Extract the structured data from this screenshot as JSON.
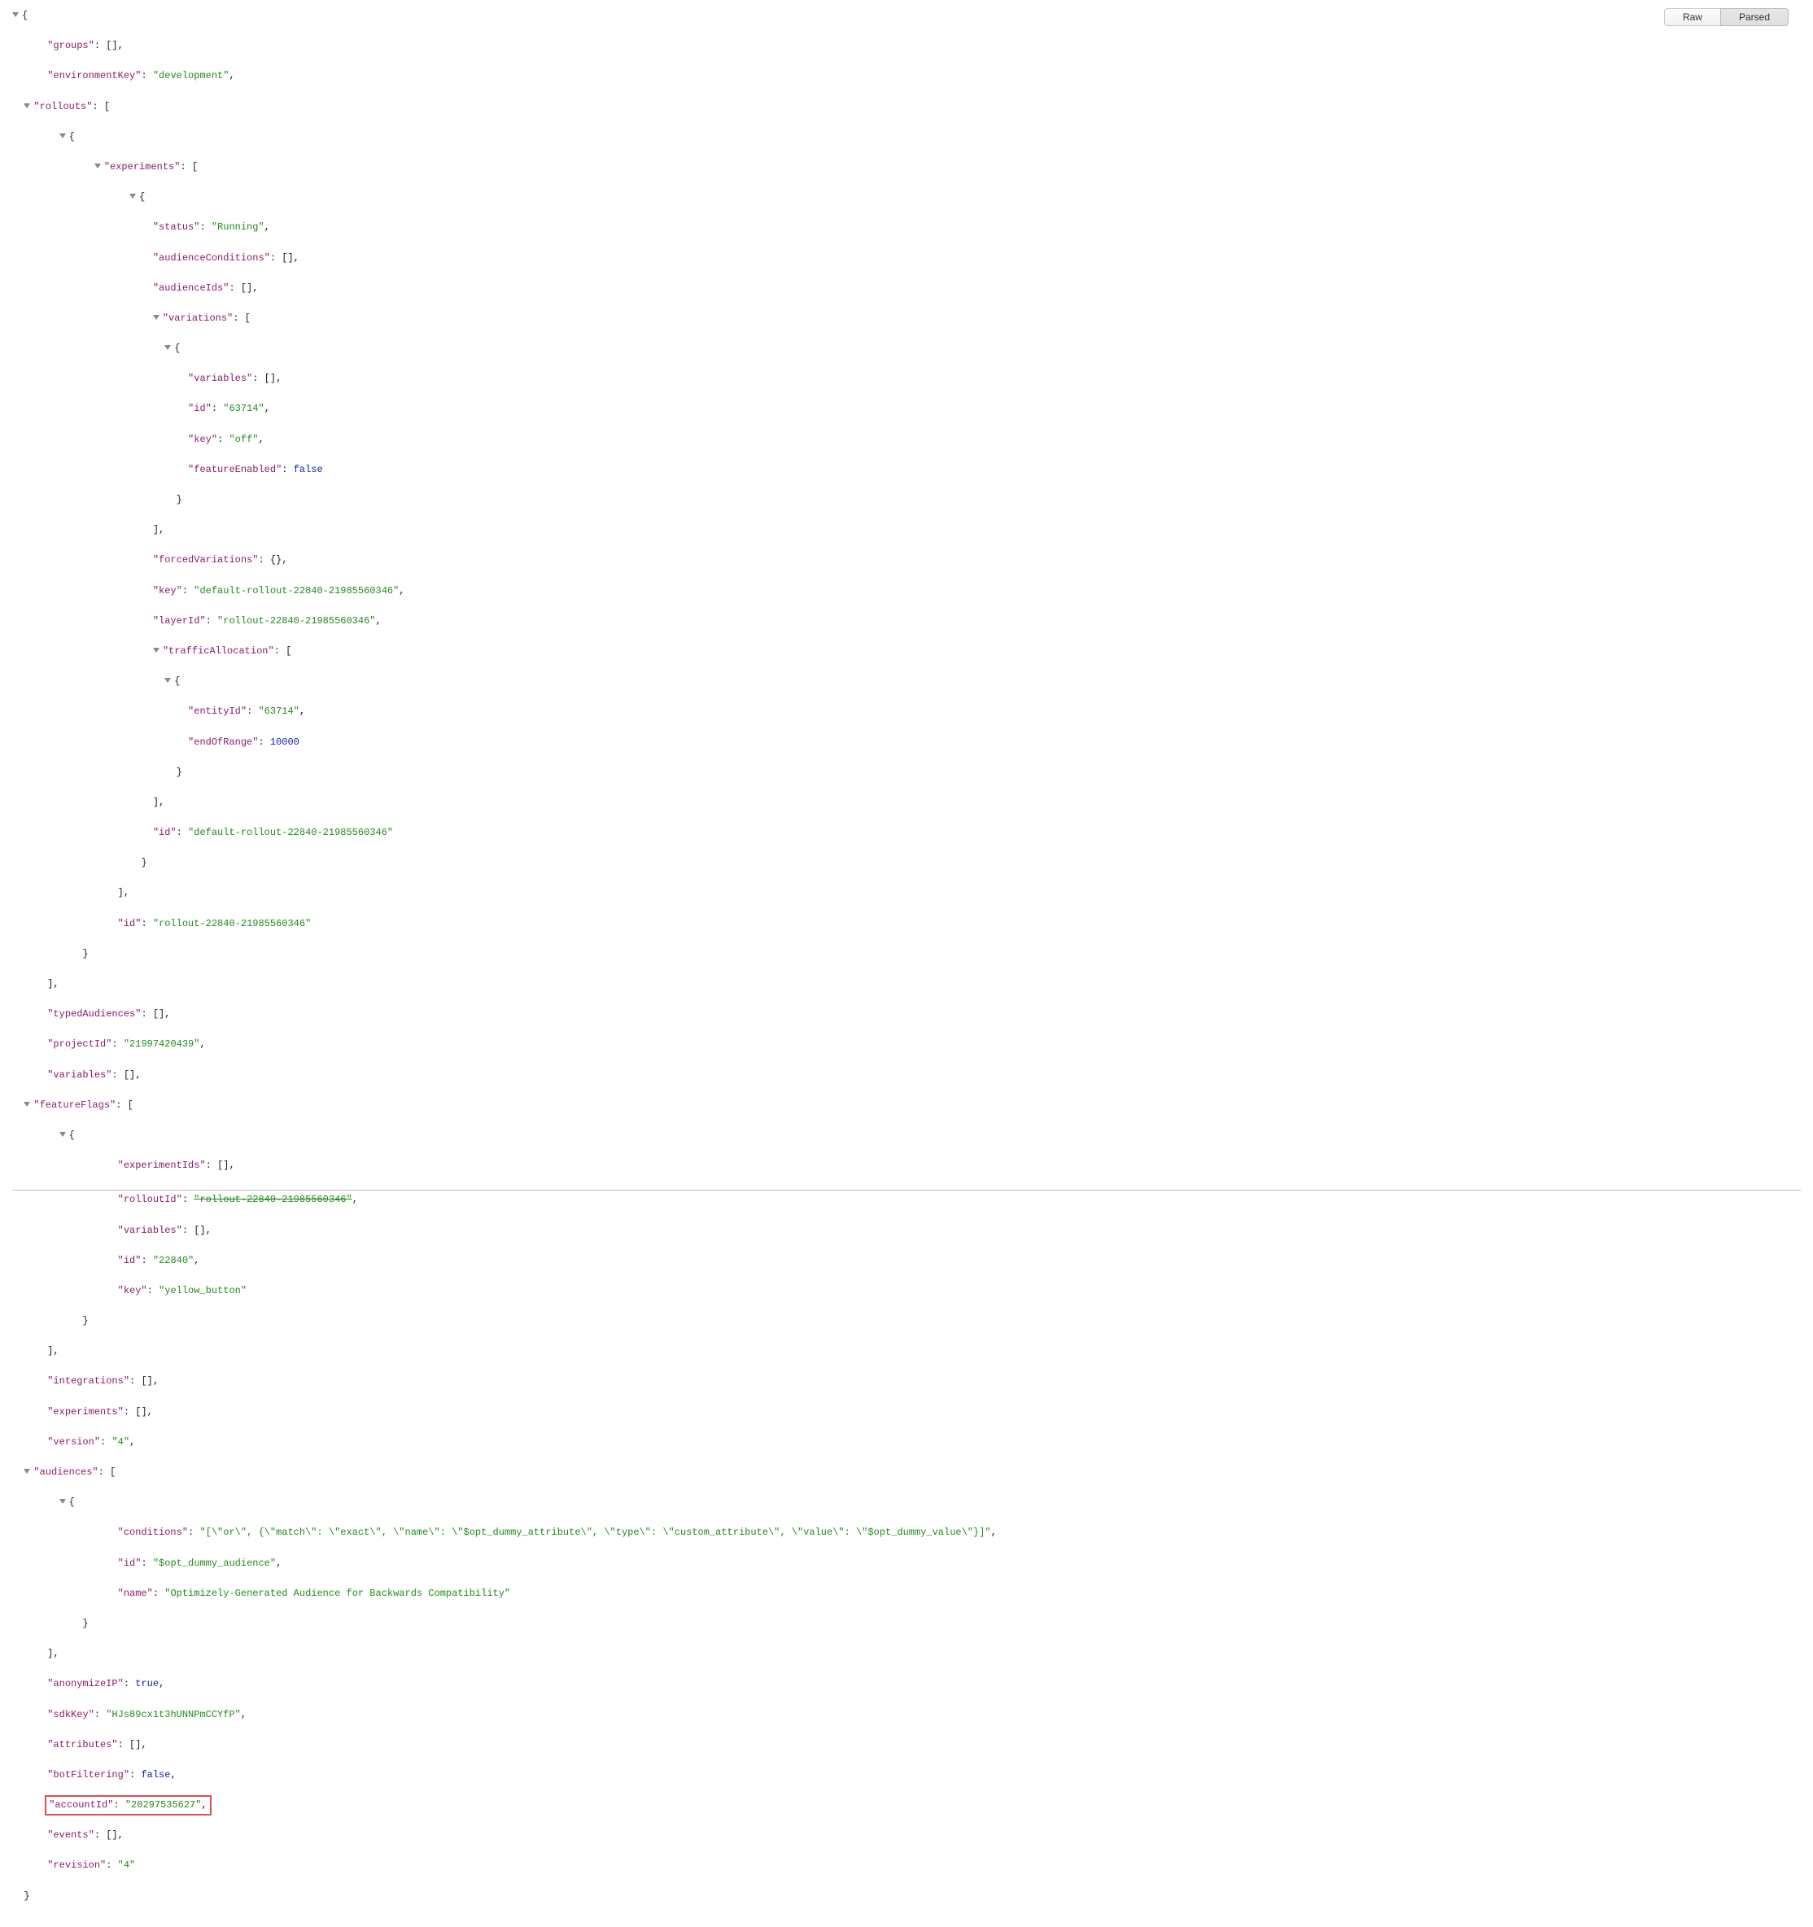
{
  "toolbar": {
    "raw": "Raw",
    "parsed": "Parsed"
  },
  "k": {
    "groups": "\"groups\"",
    "environmentKey": "\"environmentKey\"",
    "rollouts": "\"rollouts\"",
    "experiments": "\"experiments\"",
    "status": "\"status\"",
    "audienceConditions": "\"audienceConditions\"",
    "audienceIds": "\"audienceIds\"",
    "variations": "\"variations\"",
    "variables": "\"variables\"",
    "id": "\"id\"",
    "key": "\"key\"",
    "featureEnabled": "\"featureEnabled\"",
    "forcedVariations": "\"forcedVariations\"",
    "layerId": "\"layerId\"",
    "trafficAllocation": "\"trafficAllocation\"",
    "entityId": "\"entityId\"",
    "endOfRange": "\"endOfRange\"",
    "typedAudiences": "\"typedAudiences\"",
    "projectId": "\"projectId\"",
    "featureFlags": "\"featureFlags\"",
    "experimentIds": "\"experimentIds\"",
    "rolloutId": "\"rolloutId\"",
    "integrations": "\"integrations\"",
    "experimentsTop": "\"experiments\"",
    "version": "\"version\"",
    "audiences": "\"audiences\"",
    "conditions": "\"conditions\"",
    "name": "\"name\"",
    "anonymizeIP": "\"anonymizeIP\"",
    "sdkKey": "\"sdkKey\"",
    "attributes": "\"attributes\"",
    "botFiltering": "\"botFiltering\"",
    "accountId": "\"accountId\"",
    "events": "\"events\"",
    "revision": "\"revision\""
  },
  "v": {
    "environmentKey": "\"development\"",
    "status": "\"Running\"",
    "variationId": "\"63714\"",
    "variationKey": "\"off\"",
    "featureEnabled": "false",
    "experimentKey": "\"default-rollout-22840-21985560346\"",
    "layerId": "\"rollout-22840-21985560346\"",
    "entityId": "\"63714\"",
    "endOfRange": "10000",
    "experimentId": "\"default-rollout-22840-21985560346\"",
    "rolloutObjId": "\"rollout-22840-21985560346\"",
    "projectId": "\"21997420439\"",
    "ffRolloutId": "\"rollout-22840-21985560346\"",
    "ffId": "\"22840\"",
    "ffKey": "\"yellow_button\"",
    "versionStr": "\"4\"",
    "conditions": "\"[\\\"or\\\", {\\\"match\\\": \\\"exact\\\", \\\"name\\\": \\\"$opt_dummy_attribute\\\", \\\"type\\\": \\\"custom_attribute\\\", \\\"value\\\": \\\"$opt_dummy_value\\\"}]\"",
    "audId": "\"$opt_dummy_audience\"",
    "audName": "\"Optimizely-Generated Audience for Backwards Compatibility\"",
    "anonymizeIP": "true",
    "sdkKey": "\"HJs89cx1t3hUNNPmCCYfP\"",
    "botFiltering": "false",
    "accountId": "\"20297535627\"",
    "revision": "\"4\""
  },
  "p": {
    "ob": "{",
    "cb": "}",
    "os": "[",
    "cs": "]",
    "c": ",",
    "colon": ": ",
    "ea": "[]",
    "eo": "{}"
  },
  "indent": {
    "i0": "",
    "i1": "      ",
    "i2": "            ",
    "i3": "                  ",
    "i4": "                        ",
    "i5": "                              ",
    "i6": "                                    ",
    "i7": "                                          "
  }
}
